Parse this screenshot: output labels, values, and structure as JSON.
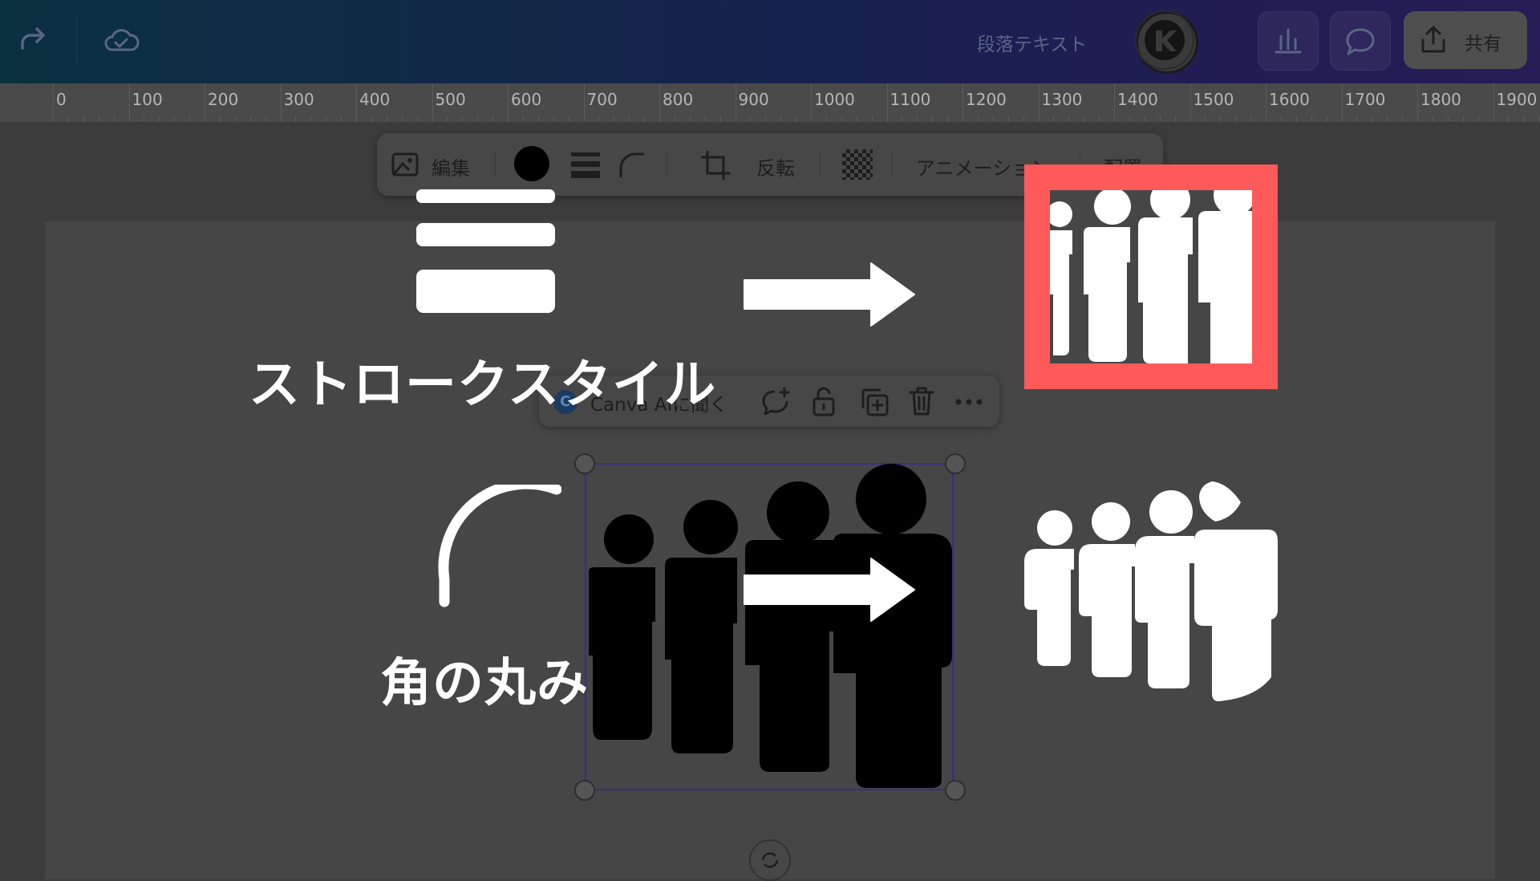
{
  "topbar": {
    "paragraph_text_label": "段落テキスト",
    "share_label": "共有",
    "icons": [
      "redo-icon",
      "cloud-saved-icon",
      "avatar-badge",
      "add-icon",
      "chart-icon",
      "comment-icon",
      "share-upload-icon"
    ]
  },
  "ruler": {
    "labels": [
      "0",
      "100",
      "200",
      "300",
      "400",
      "500",
      "600",
      "700",
      "800",
      "900",
      "1000",
      "1100",
      "1200",
      "1300",
      "1400",
      "1500",
      "1600",
      "1700",
      "1800",
      "1900"
    ]
  },
  "context_toolbar": {
    "edit_label": "編集",
    "flip_label": "反転",
    "animation_label": "アニメーション",
    "position_label": "配置",
    "icons": [
      "edit-image-icon",
      "color-swatch-icon",
      "stroke-style-icon",
      "corner-rounding-icon",
      "crop-icon",
      "transparency-icon"
    ]
  },
  "mini_toolbar": {
    "ask_ai_label": "Canva AIに聞く",
    "icons": [
      "canva-ai-icon",
      "comment-add-icon",
      "lock-icon",
      "duplicate-icon",
      "trash-icon",
      "more-icon"
    ]
  },
  "annotations": {
    "stroke_style_label": "ストロークスタイル",
    "corner_rounding_label": "角の丸み"
  },
  "colors": {
    "highlight_frame": "#ff5a5a",
    "selection_border": "#3d2a8a",
    "annotation_white": "#ffffff"
  }
}
